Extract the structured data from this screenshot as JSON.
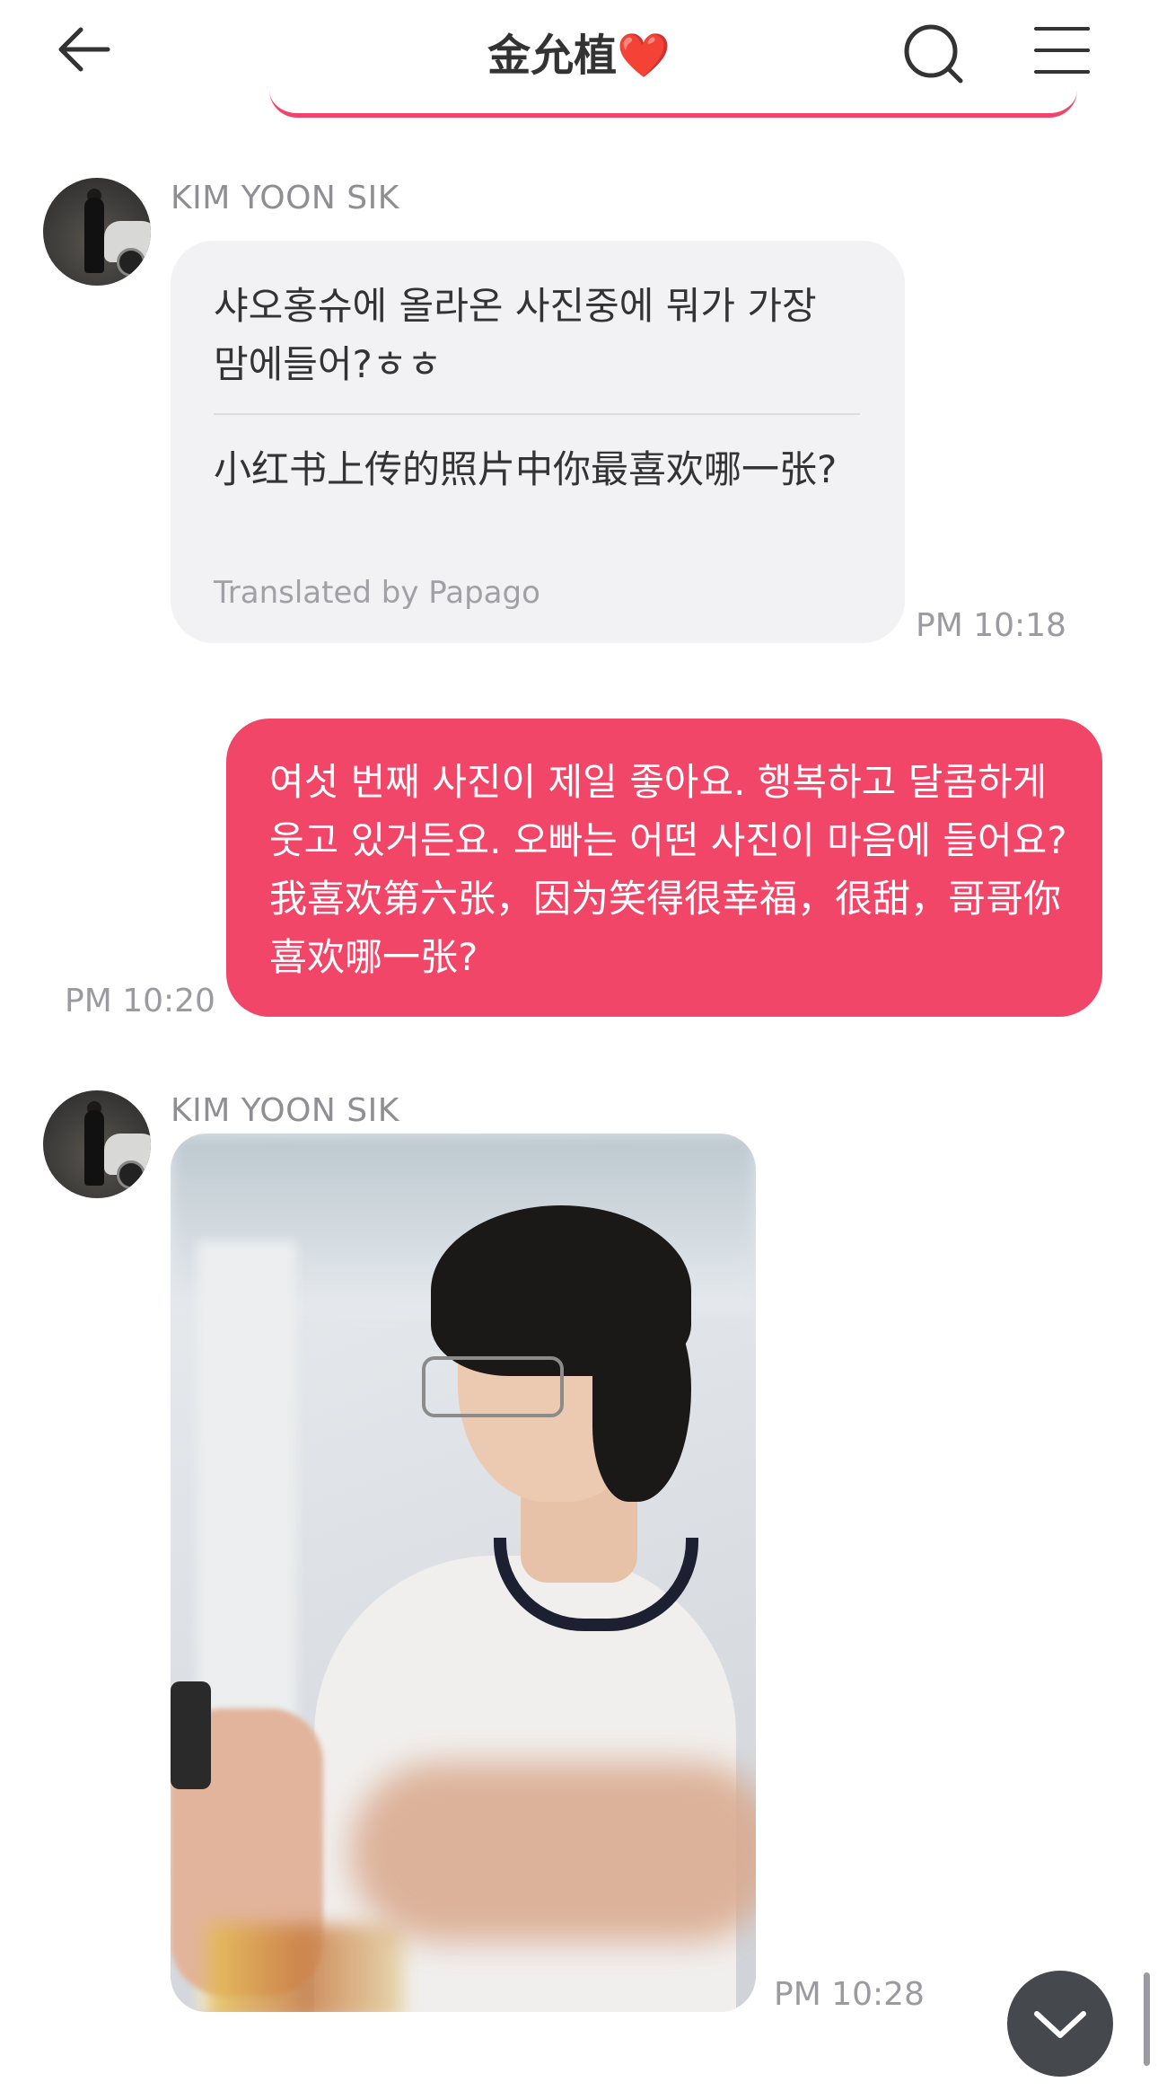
{
  "header": {
    "title": "金允植❤️",
    "back_icon": "arrow-left-icon",
    "search_icon": "search-icon",
    "menu_icon": "hamburger-menu-icon"
  },
  "messages": [
    {
      "direction": "incoming",
      "sender": "KIM YOON SIK",
      "original": "샤오홍슈에 올라온 사진중에 뭐가 가장 맘에들어?ㅎㅎ",
      "translation": "小红书上传的照片中你最喜欢哪一张?",
      "translation_credit": "Translated by Papago",
      "time": "PM 10:18"
    },
    {
      "direction": "outgoing",
      "text": "여섯 번째 사진이 제일 좋아요. 행복하고 달콤하게 웃고 있거든요. 오빠는 어떤 사진이 마음에 들어요? 我喜欢第六张，因为笑得很幸福，很甜，哥哥你喜欢哪一张?",
      "time": "PM 10:20"
    },
    {
      "direction": "incoming",
      "sender": "KIM YOON SIK",
      "type": "photo",
      "time": "PM 10:28"
    }
  ],
  "scroll_button_icon": "chevron-down-icon",
  "colors": {
    "accent": "#f24669",
    "incoming_bubble": "#f2f2f4",
    "scroll_button": "#45494e"
  }
}
